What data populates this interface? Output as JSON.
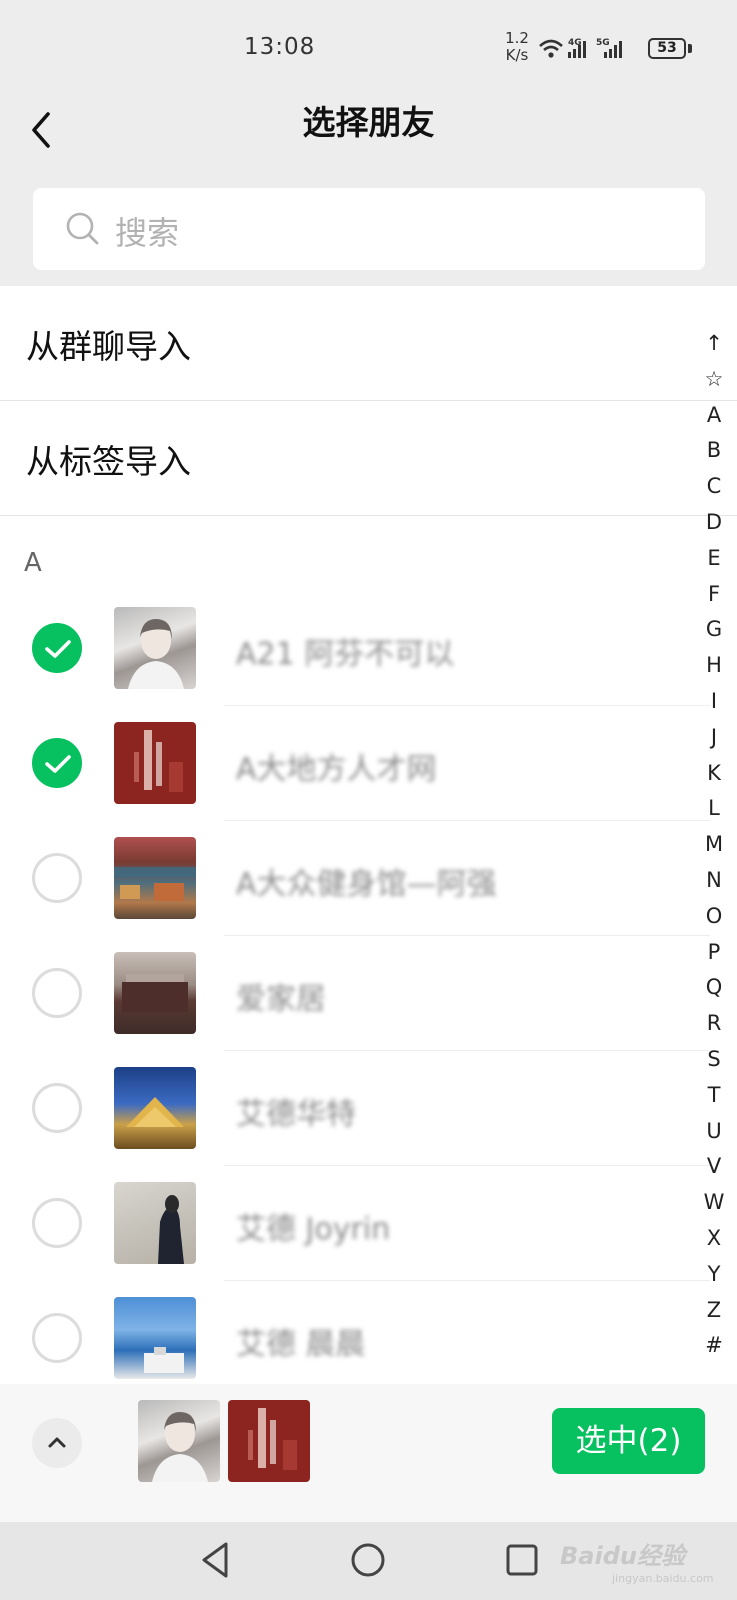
{
  "status_bar": {
    "time": "13:08",
    "net_speed_value": "1.2",
    "net_speed_unit": "K/s",
    "signal_1_label": "4G",
    "signal_2_label": "5G",
    "battery": "53"
  },
  "header": {
    "title": "选择朋友",
    "back_icon": "chevron-left-icon"
  },
  "search": {
    "placeholder": "搜索",
    "icon": "search-icon"
  },
  "import_options": [
    {
      "label": "从群聊导入"
    },
    {
      "label": "从标签导入"
    }
  ],
  "section": {
    "letter": "A"
  },
  "contacts": [
    {
      "name": "A21 阿芬不可以",
      "checked": true
    },
    {
      "name": "A大地方人才网",
      "checked": true
    },
    {
      "name": "A大众健身馆—阿强",
      "checked": false
    },
    {
      "name": "爱家居",
      "checked": false
    },
    {
      "name": "艾德华特",
      "checked": false
    },
    {
      "name": "艾德 Joyrin",
      "checked": false
    },
    {
      "name": "艾德 晨晨",
      "checked": false
    }
  ],
  "index_bar": [
    "↑",
    "☆",
    "A",
    "B",
    "C",
    "D",
    "E",
    "F",
    "G",
    "H",
    "I",
    "J",
    "K",
    "L",
    "M",
    "N",
    "O",
    "P",
    "Q",
    "R",
    "S",
    "T",
    "U",
    "V",
    "W",
    "X",
    "Y",
    "Z",
    "#"
  ],
  "bottom": {
    "confirm_label": "选中(2)",
    "expand_icon": "chevron-up-icon"
  },
  "watermark": {
    "text": "Baidu经验",
    "sub": "jingyan.baidu.com"
  },
  "colors": {
    "accent": "#07c160",
    "background": "#ededed"
  }
}
